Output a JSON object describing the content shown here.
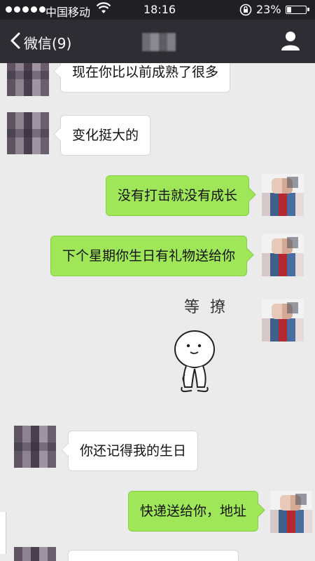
{
  "status_bar": {
    "carrier": "中国移动",
    "time": "18:16",
    "battery": "23%",
    "battery_level": 0.23
  },
  "nav": {
    "back_label": "微信(9)"
  },
  "messages": [
    {
      "side": "left",
      "text": "现在你比以前成熟了很多"
    },
    {
      "side": "left",
      "text": "变化挺大的"
    },
    {
      "side": "right",
      "text": "没有打击就没有成长"
    },
    {
      "side": "right",
      "text": "下个星期你生日有礼物送给你"
    },
    {
      "side": "right",
      "sticker_text": "等 撩"
    },
    {
      "side": "left",
      "text": "你还记得我的生日"
    },
    {
      "side": "right",
      "text": "快递送给你，地址"
    }
  ]
}
